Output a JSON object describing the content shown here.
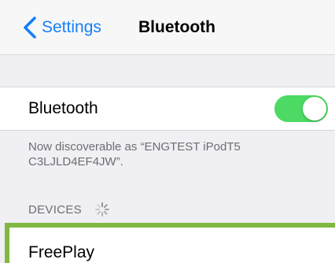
{
  "nav": {
    "back_label": "Settings",
    "title": "Bluetooth"
  },
  "bluetooth_toggle": {
    "label": "Bluetooth",
    "on": true,
    "color": "#4cd964"
  },
  "discoverable_note": "Now discoverable as “ENGTEST iPodT5\nC3LJLD4EF4JW”.",
  "devices": {
    "header": "DEVICES",
    "loading_icon": "activity-spinner-icon",
    "items": [
      {
        "label": "FreePlay",
        "highlight_color": "#80b842"
      }
    ]
  },
  "colors": {
    "accent": "#157efb",
    "background": "#efeff4"
  }
}
